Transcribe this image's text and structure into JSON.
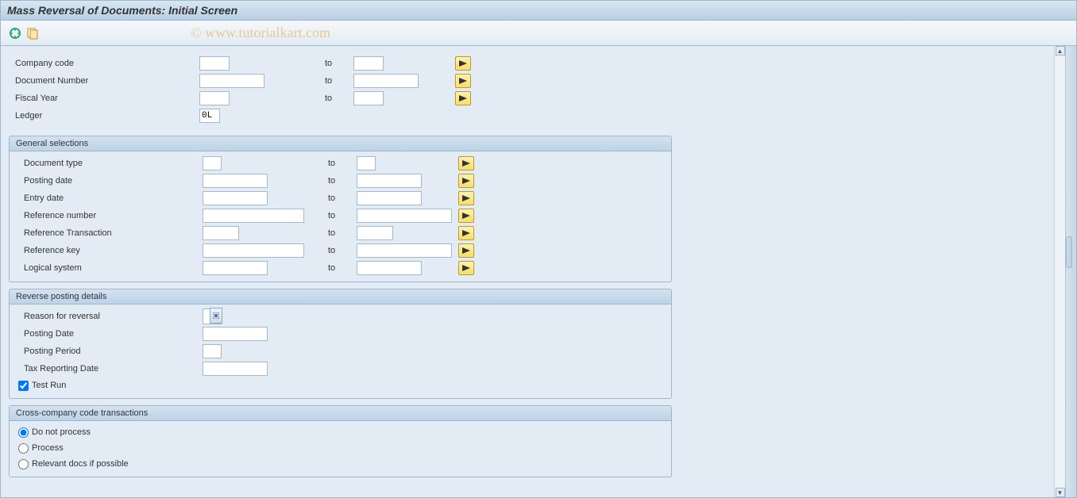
{
  "title": "Mass Reversal of Documents: Initial Screen",
  "watermark": "© www.tutorialkart.com",
  "to_label": "to",
  "top": {
    "company_code": {
      "label": "Company code",
      "low": "",
      "high": ""
    },
    "doc_number": {
      "label": "Document Number",
      "low": "",
      "high": ""
    },
    "fiscal_year": {
      "label": "Fiscal Year",
      "low": "",
      "high": ""
    },
    "ledger": {
      "label": "Ledger",
      "value": "0L"
    }
  },
  "group_general": {
    "title": "General selections",
    "doc_type": {
      "label": "Document type",
      "low": "",
      "high": ""
    },
    "post_date": {
      "label": "Posting date",
      "low": "",
      "high": ""
    },
    "entry_date": {
      "label": "Entry date",
      "low": "",
      "high": ""
    },
    "ref_num": {
      "label": "Reference number",
      "low": "",
      "high": ""
    },
    "ref_tx": {
      "label": "Reference Transaction",
      "low": "",
      "high": ""
    },
    "ref_key": {
      "label": "Reference key",
      "low": "",
      "high": ""
    },
    "log_sys": {
      "label": "Logical system",
      "low": "",
      "high": ""
    }
  },
  "group_reverse": {
    "title": "Reverse posting details",
    "reason": {
      "label": "Reason for reversal",
      "value": ""
    },
    "pdate": {
      "label": "Posting Date",
      "value": ""
    },
    "pperiod": {
      "label": "Posting Period",
      "value": ""
    },
    "taxdate": {
      "label": "Tax Reporting Date",
      "value": ""
    },
    "testrun": {
      "label": "Test Run",
      "checked": true
    }
  },
  "group_cross": {
    "title": "Cross-company code transactions",
    "opt1": {
      "label": "Do not process",
      "selected": true
    },
    "opt2": {
      "label": "Process",
      "selected": false
    },
    "opt3": {
      "label": "Relevant docs if possible",
      "selected": false
    }
  }
}
